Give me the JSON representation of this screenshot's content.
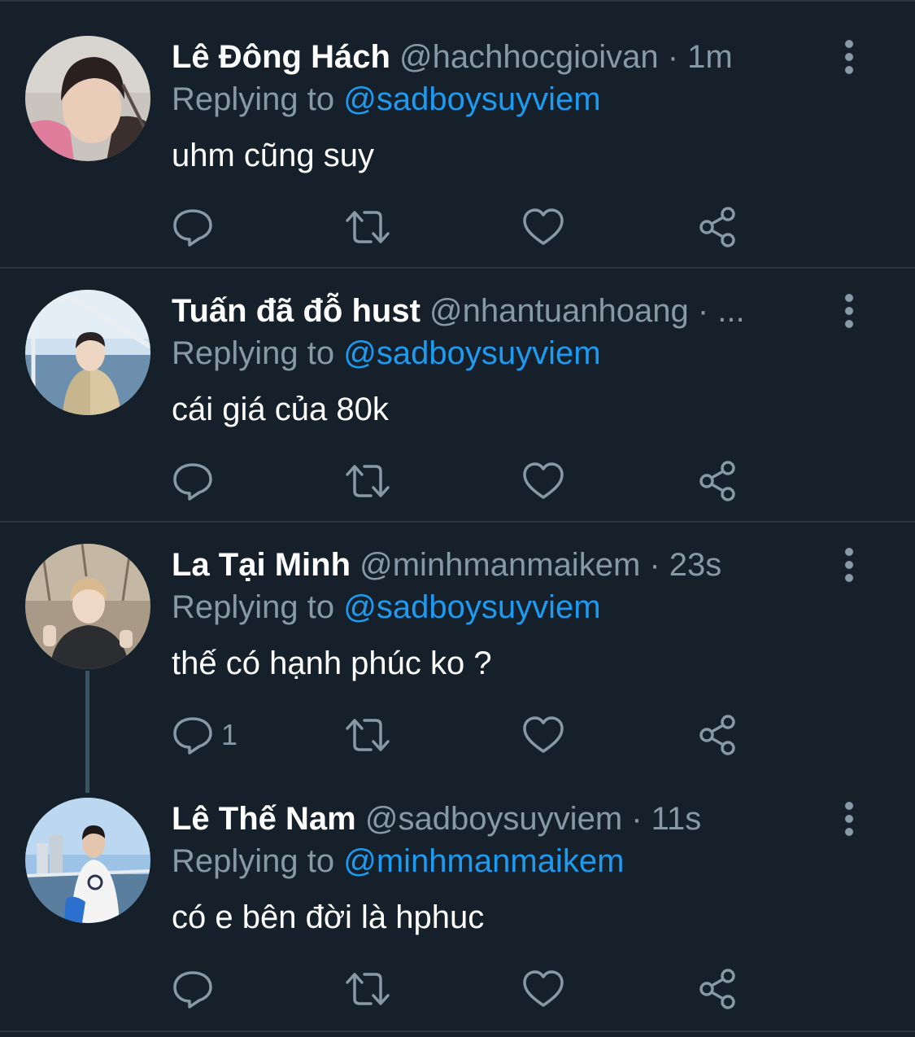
{
  "replying_label": "Replying to",
  "tweets": [
    {
      "name": "Lê Đông Hách",
      "handle": "@hachhocgioivan · 1m",
      "reply_to": "@sadboysuyviem",
      "text": "uhm cũng suy",
      "reply_count": ""
    },
    {
      "name": "Tuấn đã đỗ hust",
      "handle": "@nhantuanhoang · ...",
      "reply_to": "@sadboysuyviem",
      "text": "cái giá của 80k",
      "reply_count": ""
    },
    {
      "name": "La Tại Minh",
      "handle": "@minhmanmaikem · 23s",
      "reply_to": "@sadboysuyviem",
      "text": "thế có hạnh phúc ko ?",
      "reply_count": "1"
    },
    {
      "name": "Lê Thế Nam",
      "handle": "@sadboysuyviem · 11s",
      "reply_to": "@minhmanmaikem",
      "text": "có e bên đời là hphuc",
      "reply_count": ""
    }
  ],
  "icons": {
    "more": "more-vertical-icon",
    "reply": "reply-bubble-icon",
    "retweet": "retweet-icon",
    "like": "heart-icon",
    "share": "share-icon"
  },
  "colors": {
    "background": "#15202b",
    "mention": "#1d9bf0",
    "secondary_text": "#8899a6",
    "divider": "#2c3640",
    "thread_line": "#3d5466"
  }
}
